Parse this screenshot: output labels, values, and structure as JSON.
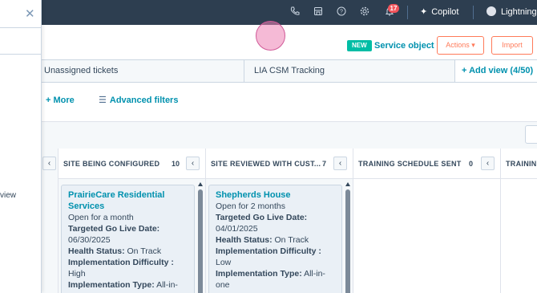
{
  "topnav": {
    "notification_count": "17",
    "copilot_label": "Copilot",
    "account_label": "Lightning"
  },
  "actionbar": {
    "new_badge": "NEW",
    "service_object_link": "Service object",
    "actions_label": "Actions ▾",
    "import_label": "Import"
  },
  "tabs": [
    {
      "label": "Unassigned tickets"
    },
    {
      "label": "LIA CSM Tracking"
    }
  ],
  "add_view_label": "+  Add view (4/50)",
  "filters": {
    "more_label": "+ More",
    "advanced_label": "Advanced filters"
  },
  "side_panel": {
    "visible_text": "view"
  },
  "board": {
    "columns": [
      {
        "title": "SITE BEING CONFIGURED",
        "count": "10",
        "card": {
          "title": "PrairieCare Residential Services",
          "lines": [
            {
              "label": "",
              "value": "Open for a month"
            },
            {
              "label": "Targeted Go Live Date:",
              "value": "06/30/2025"
            },
            {
              "label": "Health Status:",
              "value": "On Track"
            },
            {
              "label": "Implementation Difficulty :",
              "value": "High"
            },
            {
              "label": "Implementation Type:",
              "value": "All-in-"
            }
          ]
        }
      },
      {
        "title": "SITE REVIEWED WITH CUST...",
        "count": "7",
        "card": {
          "title": "Shepherds House",
          "lines": [
            {
              "label": "",
              "value": "Open for 2 months"
            },
            {
              "label": "Targeted Go Live Date:",
              "value": "04/01/2025"
            },
            {
              "label": "Health Status:",
              "value": "On Track"
            },
            {
              "label": "Implementation Difficulty :",
              "value": "Low"
            },
            {
              "label": "Implementation Type:",
              "value": "All-in-one"
            }
          ]
        }
      },
      {
        "title": "TRAINING SCHEDULE SENT",
        "count": "0"
      },
      {
        "title": "TRAINING",
        "count": ""
      }
    ]
  },
  "icons": {
    "phone": "phone-icon",
    "marketplace": "marketplace-icon",
    "help": "help-icon",
    "settings": "gear-icon",
    "notifications": "bell-icon",
    "copilot": "sparkle-icon",
    "collapse": "chevron-left-icon",
    "close": "close-icon",
    "filter": "filter-icon"
  },
  "colors": {
    "nav_bg": "#2d3e50",
    "link": "#0091ae",
    "accent": "#ff7a59",
    "new_badge": "#00bda5",
    "notification_badge": "#f2545b"
  }
}
